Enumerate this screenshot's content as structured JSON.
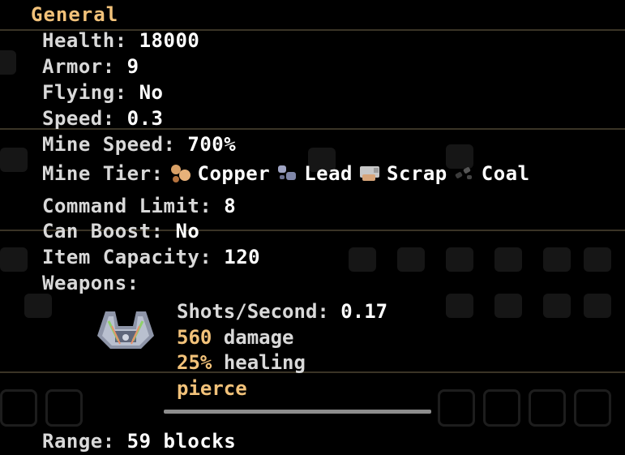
{
  "section_title": "General",
  "stats": {
    "health": {
      "label": "Health:",
      "value": "18000"
    },
    "armor": {
      "label": "Armor:",
      "value": "9"
    },
    "flying": {
      "label": "Flying:",
      "value": "No"
    },
    "speed": {
      "label": "Speed:",
      "value": "0.3"
    },
    "mine_speed": {
      "label": "Mine Speed:",
      "value": "700%"
    },
    "mine_tier": {
      "label": "Mine Tier:",
      "items": [
        {
          "name": "Copper",
          "icon": "copper-ore-icon"
        },
        {
          "name": "Lead",
          "icon": "lead-ore-icon"
        },
        {
          "name": "Scrap",
          "icon": "scrap-ore-icon"
        },
        {
          "name": "Coal",
          "icon": "coal-ore-icon"
        }
      ]
    },
    "command_limit": {
      "label": "Command Limit:",
      "value": "8"
    },
    "can_boost": {
      "label": "Can Boost:",
      "value": "No"
    },
    "item_capacity": {
      "label": "Item Capacity:",
      "value": "120"
    },
    "weapons_label": "Weapons:"
  },
  "weapon": {
    "icon": "weapon-turret-icon",
    "shots_label": "Shots/Second:",
    "shots_value": "0.17",
    "damage_value": "560",
    "damage_label": "damage",
    "healing_value": "25%",
    "healing_label": "healing",
    "trait": "pierce"
  },
  "range": {
    "label": "Range:",
    "value": "59 blocks"
  },
  "colors": {
    "accent": "#f2c27a",
    "text": "#ffffff",
    "label": "#d9d9d9",
    "background": "#000000"
  }
}
